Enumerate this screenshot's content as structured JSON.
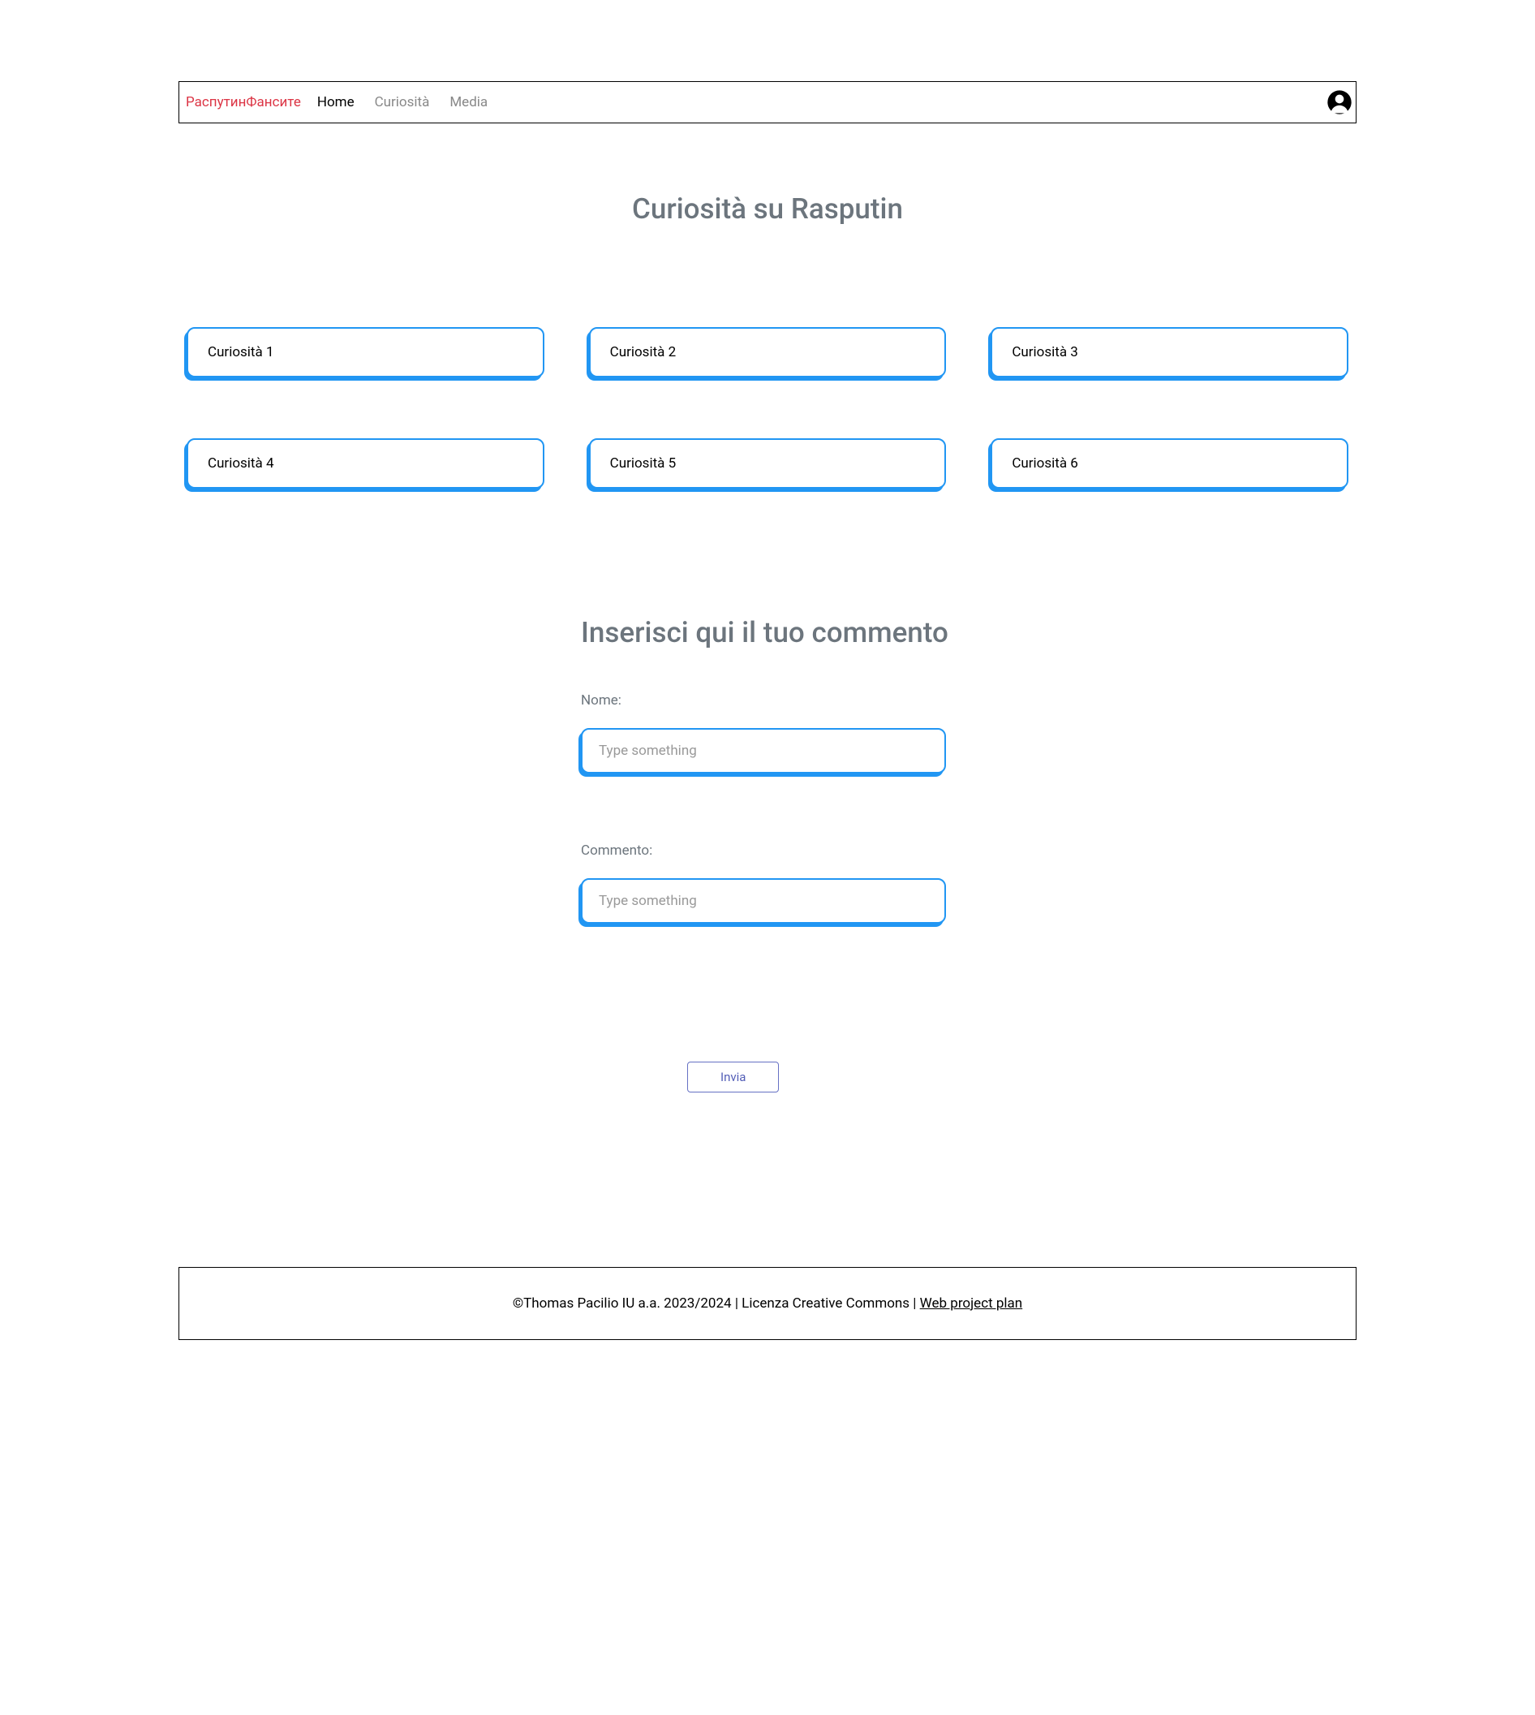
{
  "nav": {
    "brand": "РаспутинФансите",
    "links": [
      {
        "label": "Home",
        "active": true
      },
      {
        "label": "Curiosità",
        "active": false
      },
      {
        "label": "Media",
        "active": false
      }
    ]
  },
  "page_title": "Curiosità su Rasputin",
  "cards": [
    "Curiosità 1",
    "Curiosità 2",
    "Curiosità 3",
    "Curiosità 4",
    "Curiosità 5",
    "Curiosità 6"
  ],
  "comment_form": {
    "title": "Inserisci qui il tuo commento",
    "name_label": "Nome:",
    "name_placeholder": "Type something",
    "comment_label": "Commento:",
    "comment_placeholder": "Type something",
    "submit_label": "Invia"
  },
  "footer": {
    "text_prefix": "©Thomas Pacilio IU a.a. 2023/2024 | Licenza Creative Commons | ",
    "link_text": "Web project plan"
  }
}
